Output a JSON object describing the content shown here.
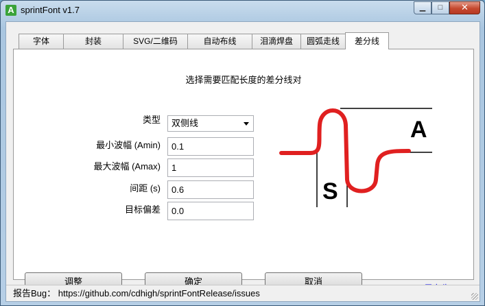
{
  "window": {
    "title": "sprintFont v1.7",
    "app_icon_letter": "A"
  },
  "tabs": [
    {
      "label": "字体"
    },
    {
      "label": "封装"
    },
    {
      "label": "SVG/二维码"
    },
    {
      "label": "自动布线"
    },
    {
      "label": "泪滴焊盘"
    },
    {
      "label": "圆弧走线"
    },
    {
      "label": "差分线"
    }
  ],
  "active_tab": "差分线",
  "panel": {
    "heading": "选择需要匹配长度的差分线对",
    "type_label": "类型",
    "type_value": "双侧线",
    "min_amp_label": "最小波幅 (Amin)",
    "min_amp_value": "0.1",
    "max_amp_label": "最大波幅 (Amax)",
    "max_amp_value": "1",
    "spacing_label": "间距 (s)",
    "spacing_value": "0.6",
    "target_label": "目标偏差",
    "target_value": "0.0",
    "diagram": {
      "label_a": "A",
      "label_s": "S",
      "trace_color": "#e02020"
    }
  },
  "buttons": {
    "adjust": "调整",
    "ok": "确定",
    "cancel": "取消",
    "save_as": "另存为"
  },
  "status": {
    "text": "报告Bug： https://github.com/cdhigh/sprintFontRelease/issues"
  }
}
